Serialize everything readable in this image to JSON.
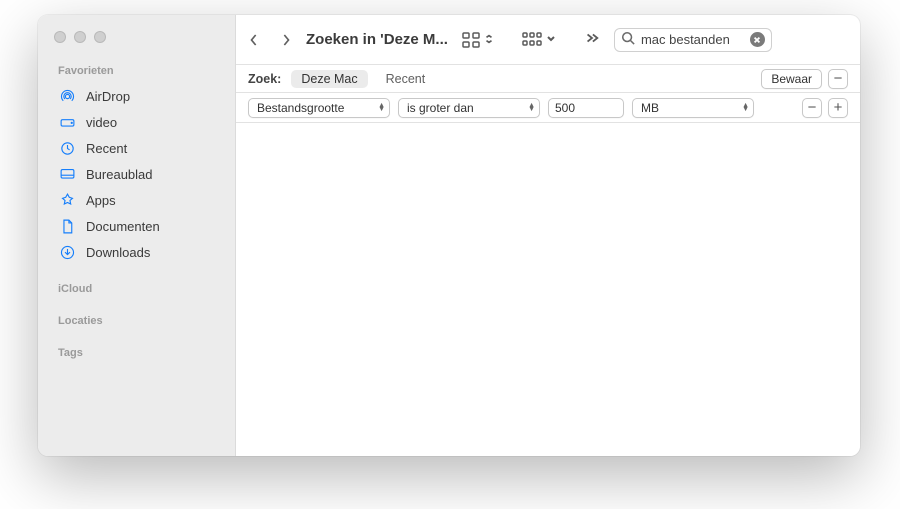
{
  "sidebar": {
    "sections": {
      "favorites_label": "Favorieten",
      "icloud_label": "iCloud",
      "locations_label": "Locaties",
      "tags_label": "Tags"
    },
    "items": [
      {
        "label": "AirDrop"
      },
      {
        "label": "video"
      },
      {
        "label": "Recent"
      },
      {
        "label": "Bureaublad"
      },
      {
        "label": "Apps"
      },
      {
        "label": "Documenten"
      },
      {
        "label": "Downloads"
      }
    ]
  },
  "toolbar": {
    "title": "Zoeken in 'Deze M...",
    "search_value": "mac bestanden"
  },
  "scope": {
    "label": "Zoek:",
    "selected": "Deze Mac",
    "other": "Recent",
    "save_label": "Bewaar"
  },
  "criteria": {
    "attribute": "Bestandsgrootte",
    "operator": "is groter dan",
    "value": "500",
    "unit": "MB"
  }
}
